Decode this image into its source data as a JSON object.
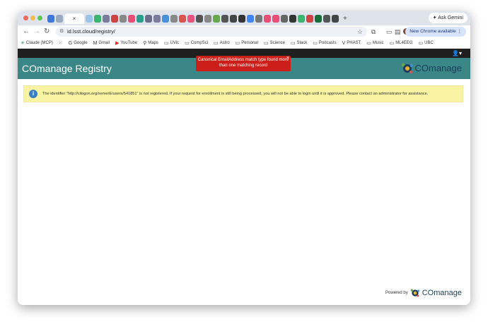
{
  "browser": {
    "active_tab_icon": "close-icon",
    "new_tab_label": "+",
    "ask_gemini_label": "Ask Gemini",
    "url": "id.lsst.cloud/registry/",
    "new_chrome_label": "New Chrome available",
    "bookmarks": [
      {
        "label": "Claude (MCP)",
        "icon": "claude-icon"
      },
      {
        "label": "",
        "icon": "apps-grid-icon"
      },
      {
        "label": "Google",
        "icon": "google-icon"
      },
      {
        "label": "Gmail",
        "icon": "gmail-icon"
      },
      {
        "label": "YouTube",
        "icon": "youtube-icon"
      },
      {
        "label": "Maps",
        "icon": "maps-icon"
      },
      {
        "label": "UVic",
        "icon": "folder-icon"
      },
      {
        "label": "CompSci",
        "icon": "folder-icon"
      },
      {
        "label": "Astro",
        "icon": "folder-icon"
      },
      {
        "label": "Personal",
        "icon": "folder-icon"
      },
      {
        "label": "Science",
        "icon": "folder-icon"
      },
      {
        "label": "Slack",
        "icon": "folder-icon"
      },
      {
        "label": "Podcasts",
        "icon": "folder-icon"
      },
      {
        "label": "PHAST",
        "icon": "phast-icon"
      },
      {
        "label": "Music",
        "icon": "folder-icon"
      },
      {
        "label": "ML4EEG",
        "icon": "folder-icon"
      },
      {
        "label": "UBC",
        "icon": "folder-icon"
      }
    ]
  },
  "app": {
    "title": "COmanage Registry",
    "logo_text": "COmanage",
    "flash_message": "Canonical EmailAddress match type found more than one matching record",
    "flash_close": "×",
    "notice": "The identifier \"http://cilogon.org/serverE/users/541851\" is not registered. If your request for enrollment is still being processed, you will not be able to login until it is approved. Please contact an administrator for assistance.",
    "info_symbol": "i",
    "powered_by": "Powered by",
    "footer_logo_text": "COmanage"
  },
  "colors": {
    "header_teal": "#3b8686",
    "flash_red": "#cc1f1a",
    "notice_yellow": "#f9f3a4",
    "info_blue": "#3b7fc4"
  }
}
